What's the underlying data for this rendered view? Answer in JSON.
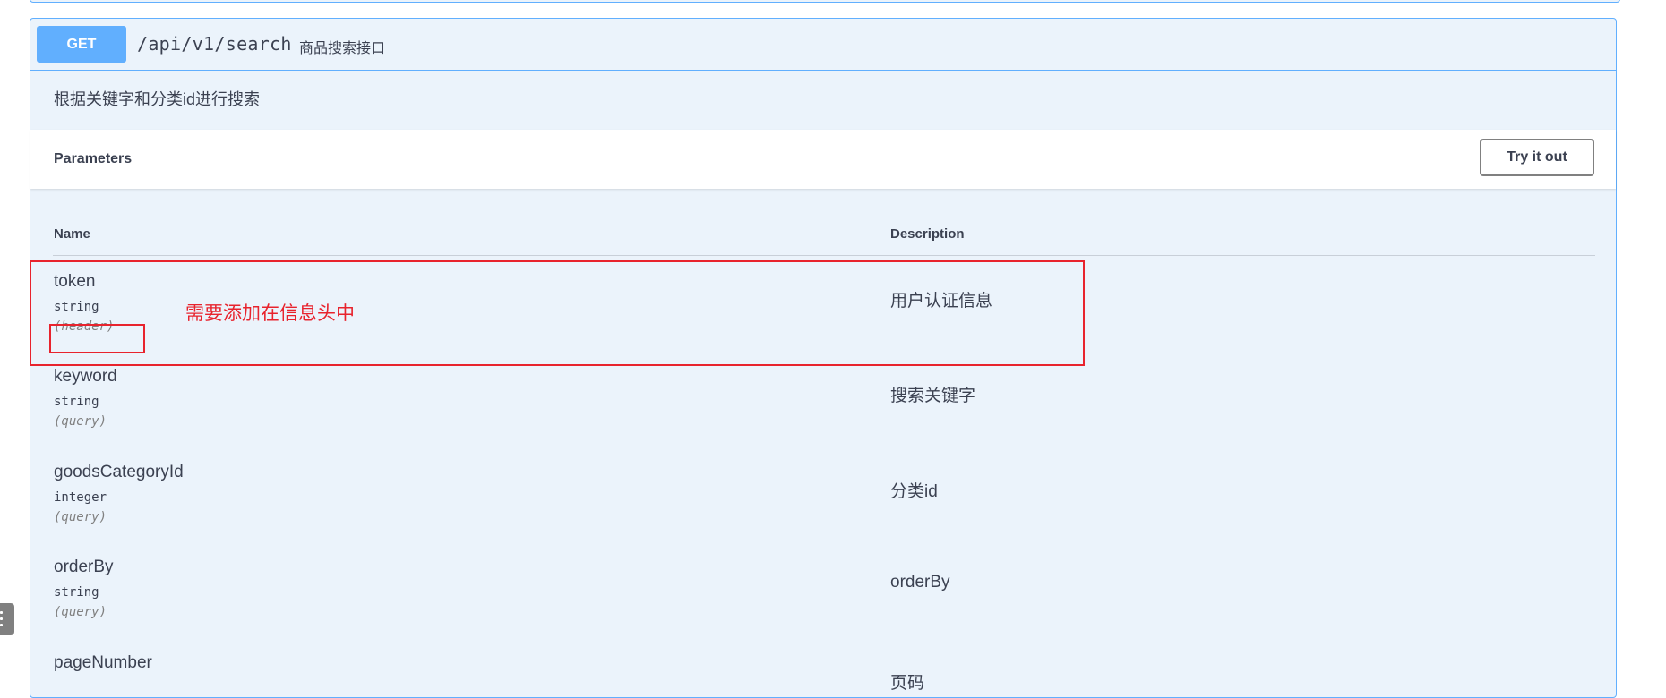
{
  "endpoint": {
    "method": "GET",
    "path": "/api/v1/search",
    "summary": "商品搜索接口",
    "description": "根据关键字和分类id进行搜索"
  },
  "parameters_section": {
    "title": "Parameters",
    "try_button": "Try it out",
    "col_name": "Name",
    "col_description": "Description"
  },
  "params": [
    {
      "name": "token",
      "type": "string",
      "in": "(header)",
      "description": "用户认证信息"
    },
    {
      "name": "keyword",
      "type": "string",
      "in": "(query)",
      "description": "搜索关键字"
    },
    {
      "name": "goodsCategoryId",
      "type": "integer",
      "in": "(query)",
      "description": "分类id"
    },
    {
      "name": "orderBy",
      "type": "string",
      "in": "(query)",
      "description": "orderBy"
    },
    {
      "name": "pageNumber",
      "type": "",
      "in": "",
      "description": "页码"
    }
  ],
  "annotation": {
    "text": "需要添加在信息头中",
    "color": "#e8232d"
  },
  "colors": {
    "get_accent": "#61affe",
    "block_bg": "#ebf3fb",
    "text": "#3b4151"
  }
}
